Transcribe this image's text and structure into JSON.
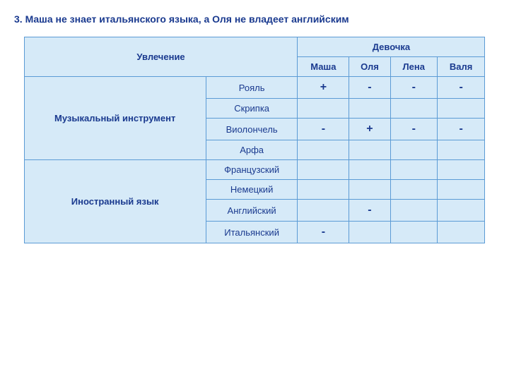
{
  "title": "3. Маша не знает итальянского языка, а Оля не владеет английским",
  "table": {
    "col_header": "Увлечение",
    "group_header": "Девочка",
    "girls": [
      "Маша",
      "Оля",
      "Лена",
      "Валя"
    ],
    "categories": [
      {
        "name": "Музыкальный инструмент",
        "rows": [
          {
            "subcategory": "Рояль",
            "values": [
              "+",
              "-",
              "-",
              "-"
            ]
          },
          {
            "subcategory": "Скрипка",
            "values": [
              "",
              "",
              "",
              ""
            ]
          },
          {
            "subcategory": "Виолончель",
            "values": [
              "-",
              "+",
              "-",
              "-"
            ]
          },
          {
            "subcategory": "Арфа",
            "values": [
              "",
              "",
              "",
              ""
            ]
          }
        ]
      },
      {
        "name": "Иностранный язык",
        "rows": [
          {
            "subcategory": "Французский",
            "values": [
              "",
              "",
              "",
              ""
            ]
          },
          {
            "subcategory": "Немецкий",
            "values": [
              "",
              "",
              "",
              ""
            ]
          },
          {
            "subcategory": "Английский",
            "values": [
              "",
              "-",
              "",
              ""
            ]
          },
          {
            "subcategory": "Итальянский",
            "values": [
              "-",
              "",
              "",
              ""
            ]
          }
        ]
      }
    ]
  }
}
